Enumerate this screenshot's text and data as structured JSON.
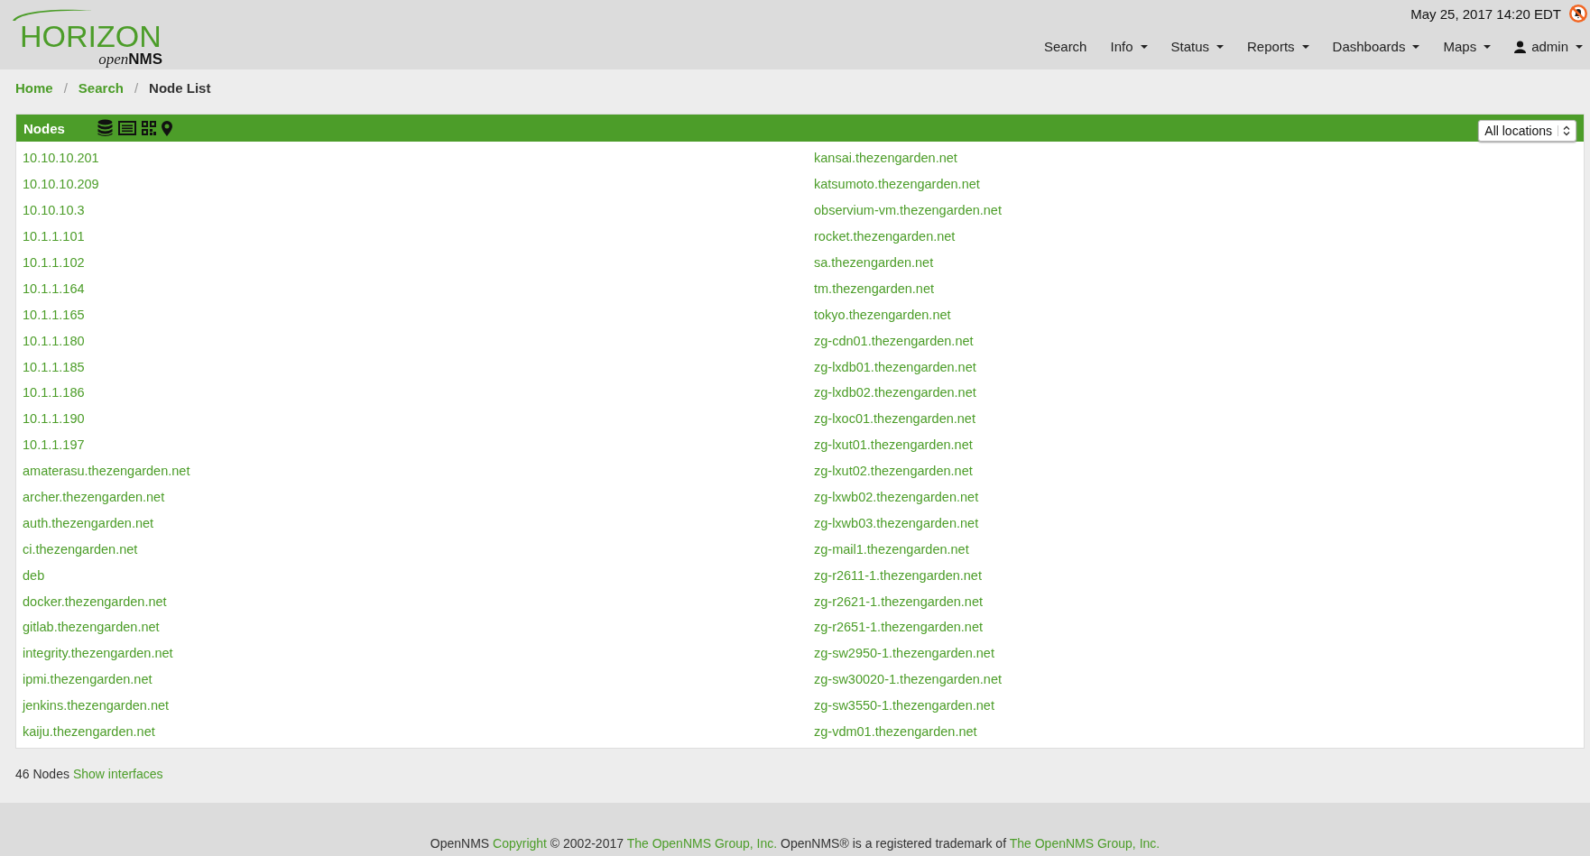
{
  "logo": {
    "title": "HORIZON",
    "subtitle": [
      "open",
      "NMS"
    ]
  },
  "datetime": "May 25, 2017 14:20 EDT",
  "notifications": {
    "muted": true
  },
  "nav": [
    {
      "label": "Search",
      "has_menu": false,
      "kind": "link"
    },
    {
      "label": "Info",
      "has_menu": true,
      "kind": "link"
    },
    {
      "label": "Status",
      "has_menu": true,
      "kind": "link"
    },
    {
      "label": "Reports",
      "has_menu": true,
      "kind": "link"
    },
    {
      "label": "Dashboards",
      "has_menu": true,
      "kind": "link"
    },
    {
      "label": "Maps",
      "has_menu": true,
      "kind": "link"
    },
    {
      "label": "admin",
      "has_menu": true,
      "kind": "user"
    }
  ],
  "breadcrumb_separator": "/",
  "breadcrumb": [
    {
      "label": "Home",
      "current": false
    },
    {
      "label": "Search",
      "current": false
    },
    {
      "label": "Node List",
      "current": true
    }
  ],
  "panel": {
    "title": "Nodes",
    "location_select": "All locations",
    "columns": [
      [
        "10.10.10.201",
        "10.10.10.209",
        "10.10.10.3",
        "10.1.1.101",
        "10.1.1.102",
        "10.1.1.164",
        "10.1.1.165",
        "10.1.1.180",
        "10.1.1.185",
        "10.1.1.186",
        "10.1.1.190",
        "10.1.1.197",
        "amaterasu.thezengarden.net",
        "archer.thezengarden.net",
        "auth.thezengarden.net",
        "ci.thezengarden.net",
        "deb",
        "docker.thezengarden.net",
        "gitlab.thezengarden.net",
        "integrity.thezengarden.net",
        "ipmi.thezengarden.net",
        "jenkins.thezengarden.net",
        "kaiju.thezengarden.net"
      ],
      [
        "kansai.thezengarden.net",
        "katsumoto.thezengarden.net",
        "observium-vm.thezengarden.net",
        "rocket.thezengarden.net",
        "sa.thezengarden.net",
        "tm.thezengarden.net",
        "tokyo.thezengarden.net",
        "zg-cdn01.thezengarden.net",
        "zg-lxdb01.thezengarden.net",
        "zg-lxdb02.thezengarden.net",
        "zg-lxoc01.thezengarden.net",
        "zg-lxut01.thezengarden.net",
        "zg-lxut02.thezengarden.net",
        "zg-lxwb02.thezengarden.net",
        "zg-lxwb03.thezengarden.net",
        "zg-mail1.thezengarden.net",
        "zg-r2611-1.thezengarden.net",
        "zg-r2621-1.thezengarden.net",
        "zg-r2651-1.thezengarden.net",
        "zg-sw2950-1.thezengarden.net",
        "zg-sw30020-1.thezengarden.net",
        "zg-sw3550-1.thezengarden.net",
        "zg-vdm01.thezengarden.net"
      ]
    ]
  },
  "summary": {
    "count": "46 Nodes",
    "link": "Show interfaces"
  },
  "footer": [
    {
      "kind": "text",
      "text": "OpenNMS"
    },
    {
      "kind": "link",
      "text": "Copyright"
    },
    {
      "kind": "text",
      "text": "© 2002-2017"
    },
    {
      "kind": "link",
      "text": "The OpenNMS Group, Inc."
    },
    {
      "kind": "text",
      "text": "OpenNMS® is a registered trademark of"
    },
    {
      "kind": "link",
      "text": "The OpenNMS Group, Inc."
    }
  ]
}
